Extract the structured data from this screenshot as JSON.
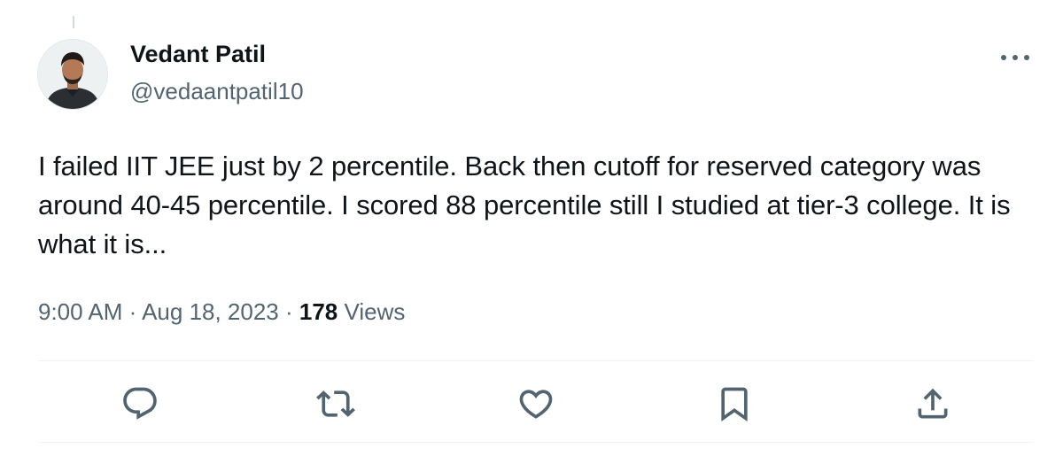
{
  "author": {
    "display_name": "Vedant Patil",
    "handle": "@vedaantpatil10"
  },
  "tweet": {
    "text": "I failed IIT JEE just by 2 percentile. Back then cutoff for reserved category was around 40-45 percentile. I scored 88 percentile still I studied at tier-3 college. It is what it is..."
  },
  "meta": {
    "time": "9:00 AM",
    "separator": " · ",
    "date": "Aug 18, 2023",
    "views_count": "178",
    "views_label": "Views"
  },
  "actions": [
    {
      "name": "reply",
      "icon": "reply-icon"
    },
    {
      "name": "retweet",
      "icon": "retweet-icon"
    },
    {
      "name": "like",
      "icon": "heart-icon"
    },
    {
      "name": "bookmark",
      "icon": "bookmark-icon"
    },
    {
      "name": "share",
      "icon": "share-icon"
    }
  ],
  "colors": {
    "text_primary": "#0f1419",
    "text_secondary": "#536471",
    "divider": "#eff3f4"
  }
}
